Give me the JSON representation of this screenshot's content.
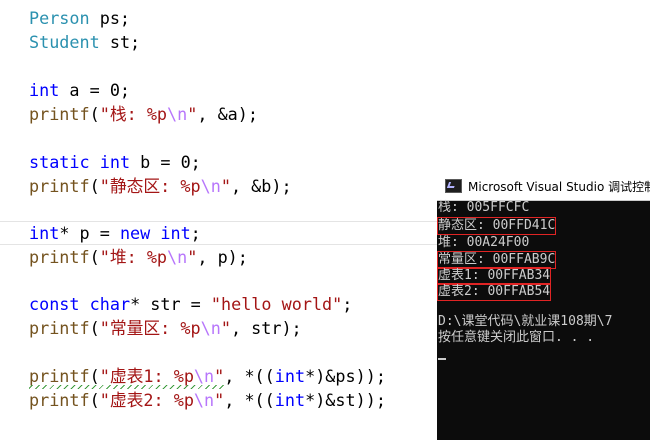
{
  "editor": {
    "lines": [
      {
        "t1": "Person",
        "t2": " ps;"
      },
      {
        "t1": "Student",
        "t2": " st;"
      },
      {
        "kw": "int",
        "rest": " a = 0;"
      },
      {
        "fn": "printf",
        "p1": "(",
        "s1": "\"栈: %p",
        "esc": "\\n",
        "s2": "\"",
        "p2": ", &a);"
      },
      {
        "kw1": "static",
        "sp": " ",
        "kw2": "int",
        "rest": " b = 0;"
      },
      {
        "fn": "printf",
        "p1": "(",
        "s1": "\"静态区: %p",
        "esc": "\\n",
        "s2": "\"",
        "p2": ", &b);"
      },
      {
        "kw1": "int",
        "a1": "* p = ",
        "kw2": "new",
        "sp": " ",
        "kw3": "int",
        "rest": ";"
      },
      {
        "fn": "printf",
        "p1": "(",
        "s1": "\"堆: %p",
        "esc": "\\n",
        "s2": "\"",
        "p2": ", p);"
      },
      {
        "kw1": "const",
        "sp": " ",
        "kw2": "char",
        "a1": "* str = ",
        "s1": "\"hello world\"",
        "rest": ";"
      },
      {
        "fn": "printf",
        "p1": "(",
        "s1": "\"常量区: %p",
        "esc": "\\n",
        "s2": "\"",
        "p2": ", str);"
      },
      {
        "fn": "printf",
        "p1": "(",
        "s1": "\"虚表1: %p",
        "esc": "\\n",
        "s2": "\"",
        "p2": ", *((",
        "kw": "int",
        "p3": "*)&ps));"
      },
      {
        "fn": "printf",
        "p1": "(",
        "s1": "\"虚表2: %p",
        "esc": "\\n",
        "s2": "\"",
        "p2": ", *((",
        "kw": "int",
        "p3": "*)&st));"
      }
    ]
  },
  "console": {
    "title": "Microsoft Visual Studio 调试控制台",
    "output": [
      "栈: 005FFCFC",
      "静态区: 00FFD41C",
      "堆: 00A24F00",
      "常量区: 00FFAB9C",
      "虚表1: 00FFAB34",
      "虚表2: 00FFAB54",
      "",
      "D:\\课堂代码\\就业课108期\\7",
      "按任意键关闭此窗口. . ."
    ]
  },
  "colors": {
    "keyword": "#0000ff",
    "type": "#2b91af",
    "function": "#74531f",
    "string": "#a31515",
    "escape": "#b776fb",
    "highlight_box": "#e02424",
    "console_bg": "#0c0c0c"
  }
}
